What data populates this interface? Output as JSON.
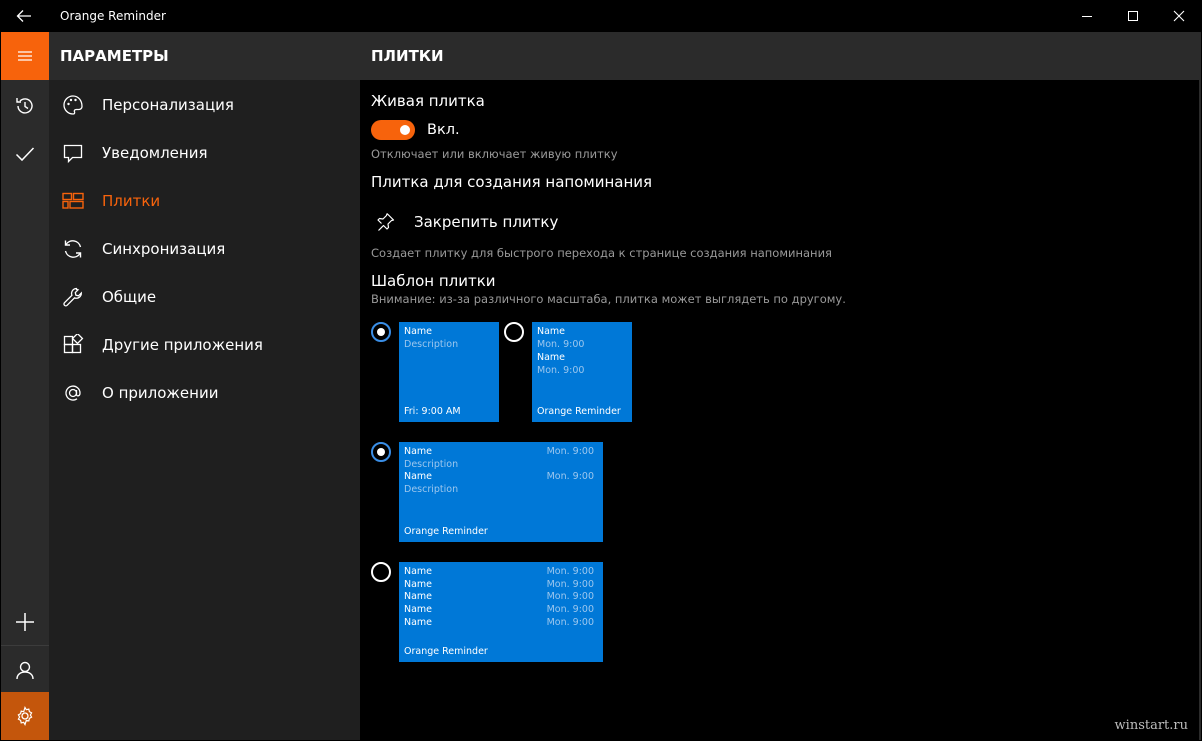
{
  "window": {
    "title": "Orange Reminder",
    "back_icon": "arrow-left-icon",
    "minimize_icon": "minimize-icon",
    "maximize_icon": "maximize-icon",
    "close_icon": "close-icon"
  },
  "colors": {
    "accent": "#f7630c",
    "tile_blue": "#0078d7",
    "rail_bg": "#2b2b2b",
    "menu_bg": "#1f1f1f"
  },
  "rail": {
    "hamburger_icon": "hamburger-icon",
    "history_icon": "history-icon",
    "check_icon": "check-icon",
    "add_icon": "plus-icon",
    "user_icon": "user-icon",
    "settings_icon": "gear-icon"
  },
  "menu": {
    "header": "ПАРАМЕТРЫ",
    "items": [
      {
        "label": "Персонализация",
        "icon": "palette-icon"
      },
      {
        "label": "Уведомления",
        "icon": "message-icon"
      },
      {
        "label": "Плитки",
        "icon": "tiles-icon",
        "active": true
      },
      {
        "label": "Синхронизация",
        "icon": "sync-icon"
      },
      {
        "label": "Общие",
        "icon": "wrench-icon"
      },
      {
        "label": "Другие приложения",
        "icon": "apps-icon"
      },
      {
        "label": "О приложении",
        "icon": "at-icon"
      }
    ]
  },
  "content": {
    "header": "ПЛИТКИ",
    "live_tile": {
      "title": "Живая плитка",
      "toggle_state": "Вкл.",
      "toggle_on": true,
      "hint": "Отключает или включает живую плитку"
    },
    "reminder_tile": {
      "title": "Плитка для создания напоминания",
      "pin_label": "Закрепить плитку",
      "pin_icon": "pin-icon",
      "hint": "Создает плитку для быстрого перехода к странице создания напоминания"
    },
    "template": {
      "title": "Шаблон плитки",
      "hint": "Внимание: из-за различного масштаба, плитка может выглядеть по другому.",
      "tile_a": {
        "name": "Name",
        "description": "Description",
        "footer": "Fri: 9:00 AM",
        "selected": true
      },
      "tile_b": {
        "name1": "Name",
        "time1": "Mon. 9:00",
        "name2": "Name",
        "time2": "Mon. 9:00",
        "footer": "Orange Reminder",
        "selected": false
      },
      "tile_c": {
        "name1": "Name",
        "time1": "Mon. 9:00",
        "desc1": "Description",
        "name2": "Name",
        "time2": "Mon. 9:00",
        "desc2": "Description",
        "footer": "Orange Reminder",
        "selected": true
      },
      "tile_d": {
        "rows": [
          {
            "name": "Name",
            "time": "Mon. 9:00"
          },
          {
            "name": "Name",
            "time": "Mon. 9:00"
          },
          {
            "name": "Name",
            "time": "Mon. 9:00"
          },
          {
            "name": "Name",
            "time": "Mon. 9:00"
          },
          {
            "name": "Name",
            "time": "Mon. 9:00"
          }
        ],
        "footer": "Orange Reminder",
        "selected": false
      }
    }
  },
  "watermark": "winstart.ru"
}
